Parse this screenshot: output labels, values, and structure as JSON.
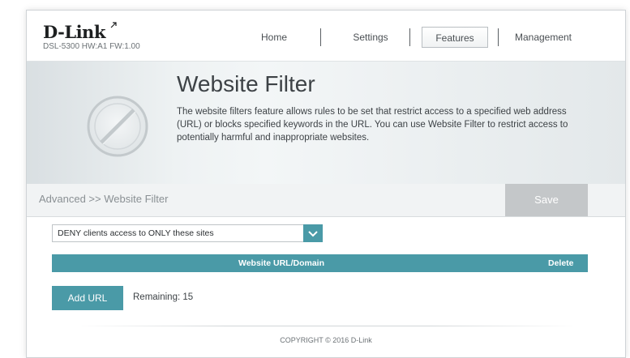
{
  "header": {
    "logo": "D-Link",
    "model": "DSL-5300 HW:A1 FW:1.00",
    "nav": [
      {
        "label": "Home",
        "active": false
      },
      {
        "label": "Settings",
        "active": false
      },
      {
        "label": "Features",
        "active": true
      },
      {
        "label": "Management",
        "active": false
      }
    ]
  },
  "banner": {
    "title": "Website Filter",
    "description": "The website filters feature allows rules to be set that restrict access to a specified web address (URL) or blocks specified keywords in the URL. You can use Website Filter to restrict access to potentially harmful and inappropriate websites."
  },
  "breadcrumb": "Advanced >> Website Filter",
  "save_label": "Save",
  "filter_mode": {
    "selected": "DENY clients access to ONLY these sites"
  },
  "table": {
    "columns": [
      "Website URL/Domain",
      "Delete"
    ]
  },
  "add_url_label": "Add URL",
  "remaining": "Remaining: 15",
  "copyright": "COPYRIGHT © 2016 D-Link",
  "colors": {
    "accent": "#4a9aa7",
    "save_disabled": "#c4c7c9"
  },
  "icons": {
    "banner": "filter-prohibited-icon",
    "select_arrow": "chevron-down-icon"
  }
}
